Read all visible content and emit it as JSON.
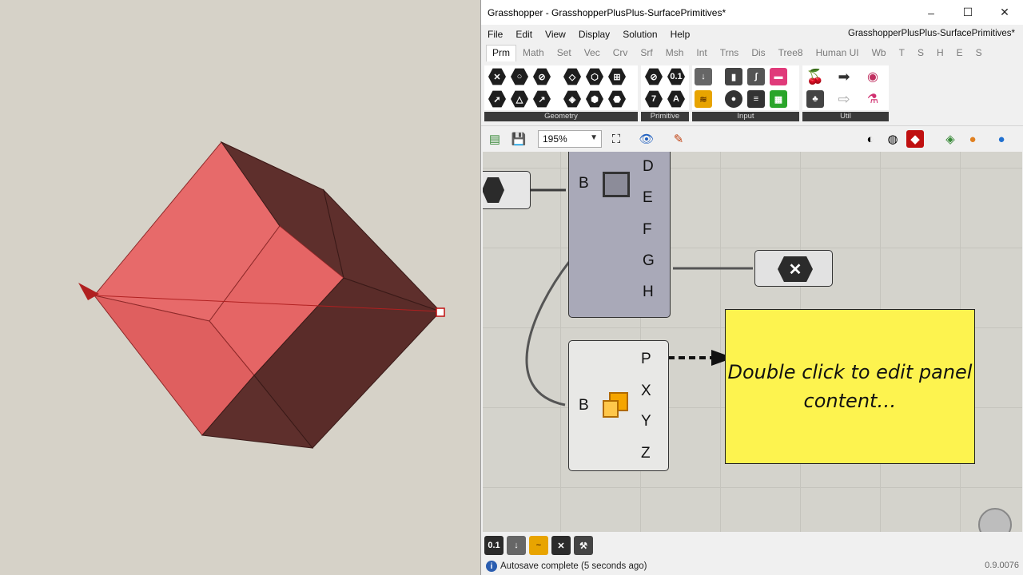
{
  "window": {
    "title": "Grasshopper - GrasshopperPlusPlus-SurfacePrimitives*",
    "minimize": "–",
    "maximize": "☐",
    "close": "✕",
    "document_name": "GrasshopperPlusPlus-SurfacePrimitives*"
  },
  "menu": [
    "File",
    "Edit",
    "View",
    "Display",
    "Solution",
    "Help"
  ],
  "tabs": [
    "Prm",
    "Math",
    "Set",
    "Vec",
    "Crv",
    "Srf",
    "Msh",
    "Int",
    "Trns",
    "Dis",
    "Tree8",
    "Human UI",
    "Wb",
    "T",
    "S",
    "H",
    "E",
    "S"
  ],
  "ribbon": {
    "groups": [
      {
        "label": "Geometry"
      },
      {
        "label": "Primitive",
        "icons": [
          "0.1",
          "7",
          "A"
        ]
      },
      {
        "label": "Input"
      },
      {
        "label": "Util"
      }
    ]
  },
  "toolbar": {
    "zoom": "195%"
  },
  "canvas": {
    "grey_component": {
      "input": "B",
      "outputs": [
        "D",
        "E",
        "F",
        "G",
        "H"
      ]
    },
    "light_component": {
      "input": "B",
      "outputs": [
        "P",
        "X",
        "Y",
        "Z"
      ]
    },
    "panel_text": "Double click to edit panel content…"
  },
  "bottom_icons": [
    "0.1",
    "↓",
    "~",
    "✕",
    "⚒"
  ],
  "status": {
    "text": "Autosave complete (5 seconds ago)",
    "version": "0.9.0076"
  },
  "colors": {
    "cube_light": "#e76a6a",
    "cube_dark": "#5e2f2c",
    "panel": "#fdf34f",
    "component_grey": "#a9a9b8"
  }
}
